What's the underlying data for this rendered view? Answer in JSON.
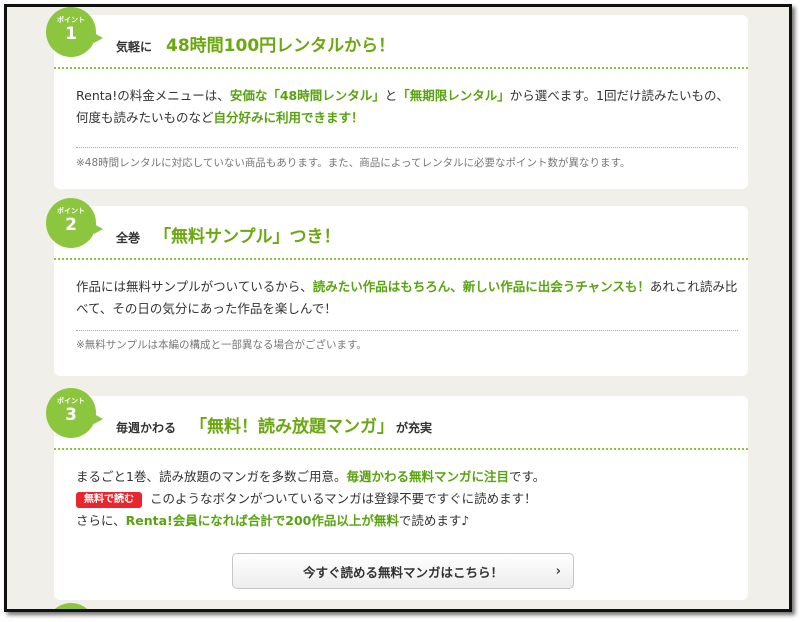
{
  "points": [
    {
      "label": "ポイント",
      "number": "1",
      "title_small": "気軽に",
      "title_big": "48時間100円レンタルから！",
      "body_pre": "Renta!の料金メニューは、",
      "body_em1": "安価な「48時間レンタル」",
      "body_mid": "と",
      "body_em2": "「無期限レンタル」",
      "body_post": "から選べます。1回だけ読みたいもの、何度も読みたいものなど",
      "body_em3": "自分好みに利用できます！",
      "note": "※48時間レンタルに対応していない商品もあります。また、商品によってレンタルに必要なポイント数が異なります。"
    },
    {
      "label": "ポイント",
      "number": "2",
      "title_small": "全巻",
      "title_big": "「無料サンプル」つき！",
      "body_pre": "作品には無料サンプルがついているから、",
      "body_em1": "読みたい作品はもちろん、新しい作品に出会うチャンスも！",
      "body_post": "あれこれ読み比べて、その日の気分にあった作品を楽しんで！",
      "note": "※無料サンプルは本編の構成と一部異なる場合がございます。"
    },
    {
      "label": "ポイント",
      "number": "3",
      "title_small": "毎週かわる",
      "title_big": "「無料！読み放題マンガ」",
      "title_after": "が充実",
      "line1_pre": "まるごと1巻、読み放題のマンガを多数ご用意。",
      "line1_em": "毎週かわる無料マンガに注目",
      "line1_post": "です。",
      "tag": "無料で読む",
      "line2": "このようなボタンがついているマンガは登録不要ですぐに読めます！",
      "line3_pre": "さらに、",
      "line3_em": "Renta!会員になれば合計で200作品以上が無料",
      "line3_post": "で読めます♪",
      "cta": "今すぐ読める無料マンガはこちら！",
      "cta_chevron": "›"
    }
  ],
  "colors": {
    "accent_green": "#8cc63e",
    "text_green": "#58a30f",
    "tag_red": "#e8262d"
  }
}
